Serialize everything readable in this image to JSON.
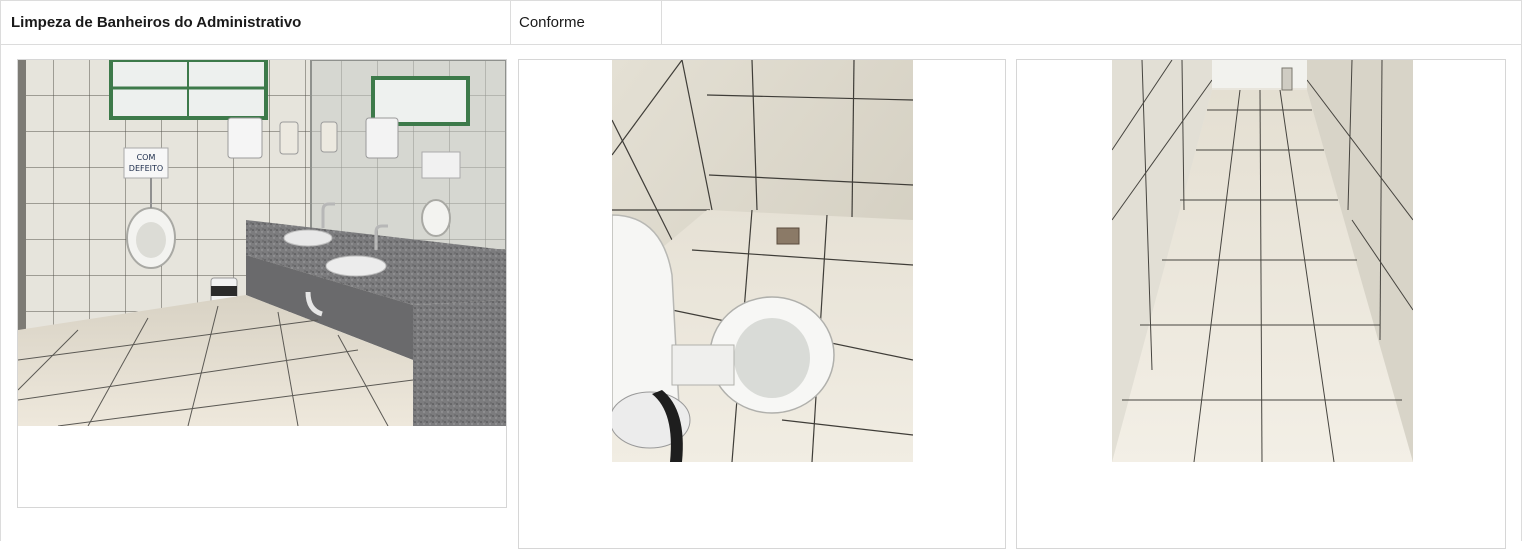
{
  "header": {
    "title": "Limpeza de Banheiros do Administrativo",
    "status": "Conforme"
  },
  "photos": [
    {
      "subject": "sink-counter-urinal-photo",
      "sign_line1": "COM",
      "sign_line2": "DEFEITO"
    },
    {
      "subject": "toilet-photo"
    },
    {
      "subject": "corridor-floor-photo"
    }
  ]
}
